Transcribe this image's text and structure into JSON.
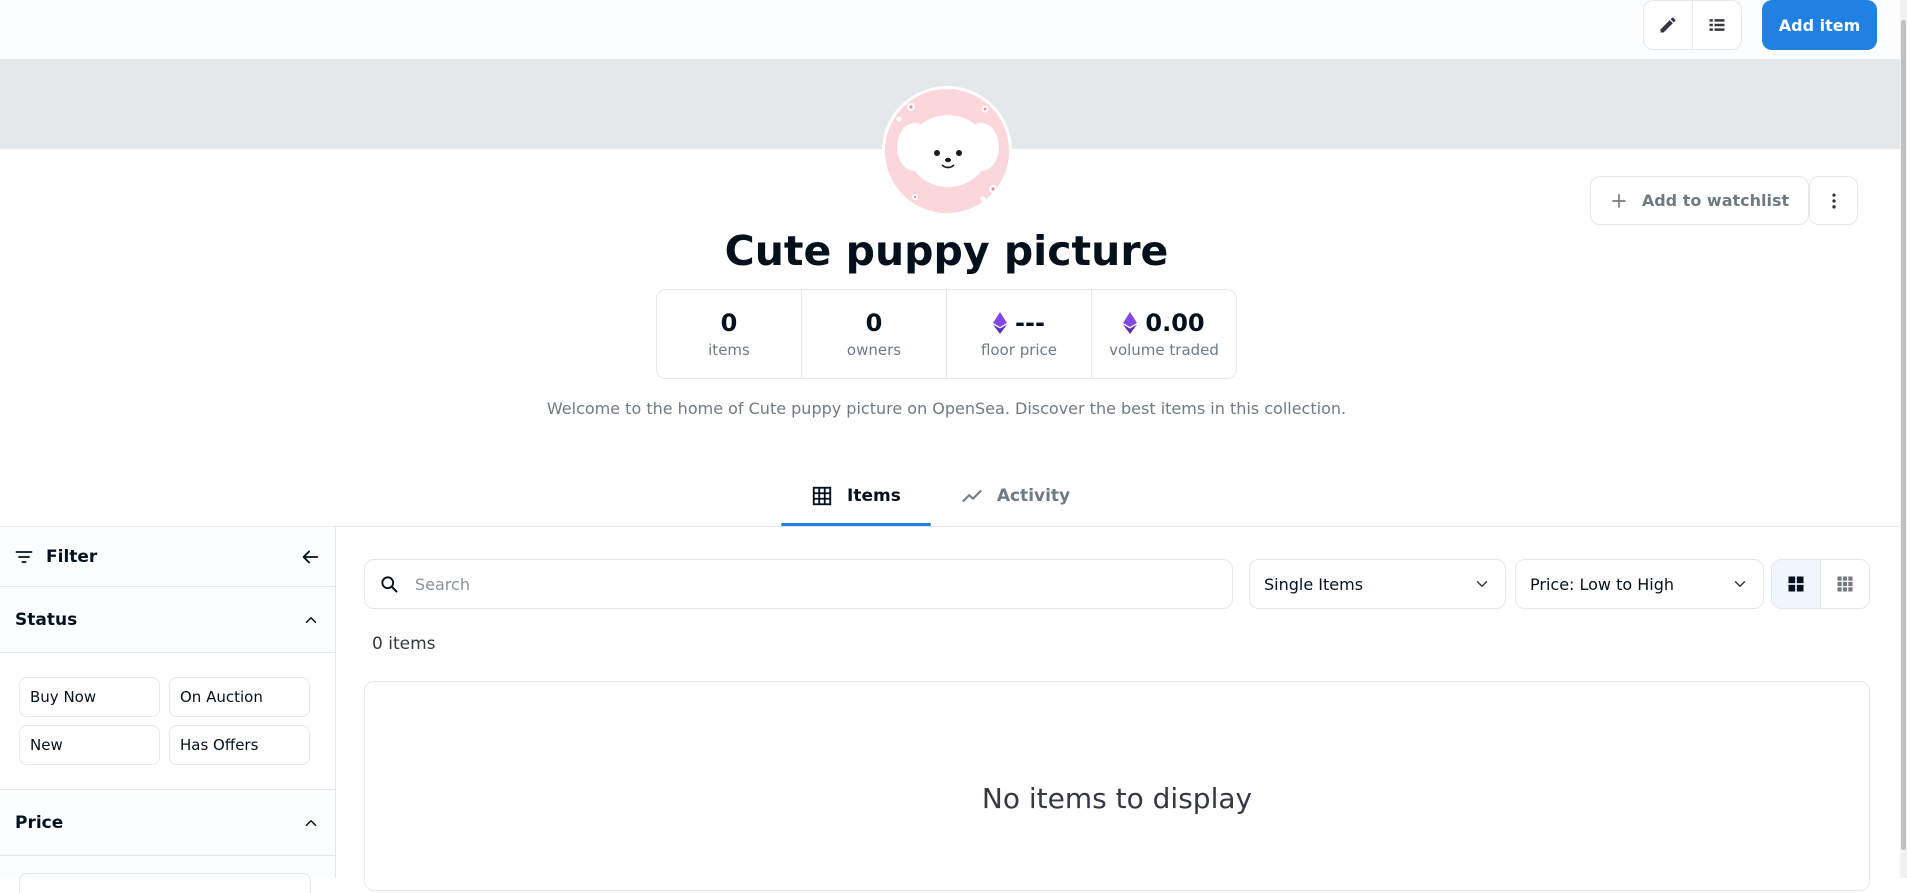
{
  "toolbar": {
    "edit_icon": "pencil-icon",
    "list_icon": "list-view-icon",
    "add_item_label": "Add item",
    "accent_color": "#2081e2"
  },
  "collection": {
    "title": "Cute puppy picture",
    "avatar_icon": "puppy-avatar",
    "watchlist_label": "Add to watchlist",
    "description": "Welcome to the home of Cute puppy picture on OpenSea. Discover the best items in this collection.",
    "stats": [
      {
        "value": "0",
        "label": "items",
        "eth": false
      },
      {
        "value": "0",
        "label": "owners",
        "eth": false
      },
      {
        "value": "---",
        "label": "floor price",
        "eth": true
      },
      {
        "value": "0.00",
        "label": "volume traded",
        "eth": true
      }
    ]
  },
  "tabs": [
    {
      "label": "Items",
      "active": true,
      "icon": "grid-icon"
    },
    {
      "label": "Activity",
      "active": false,
      "icon": "activity-chart-icon"
    }
  ],
  "sidebar": {
    "filter_label": "Filter",
    "status_label": "Status",
    "status_options": [
      "Buy Now",
      "On Auction",
      "New",
      "Has Offers"
    ],
    "price_label": "Price"
  },
  "main": {
    "search_placeholder": "Search",
    "type_select": "Single Items",
    "sort_select": "Price: Low to High",
    "item_count": "0 items",
    "empty_message": "No items to display"
  }
}
